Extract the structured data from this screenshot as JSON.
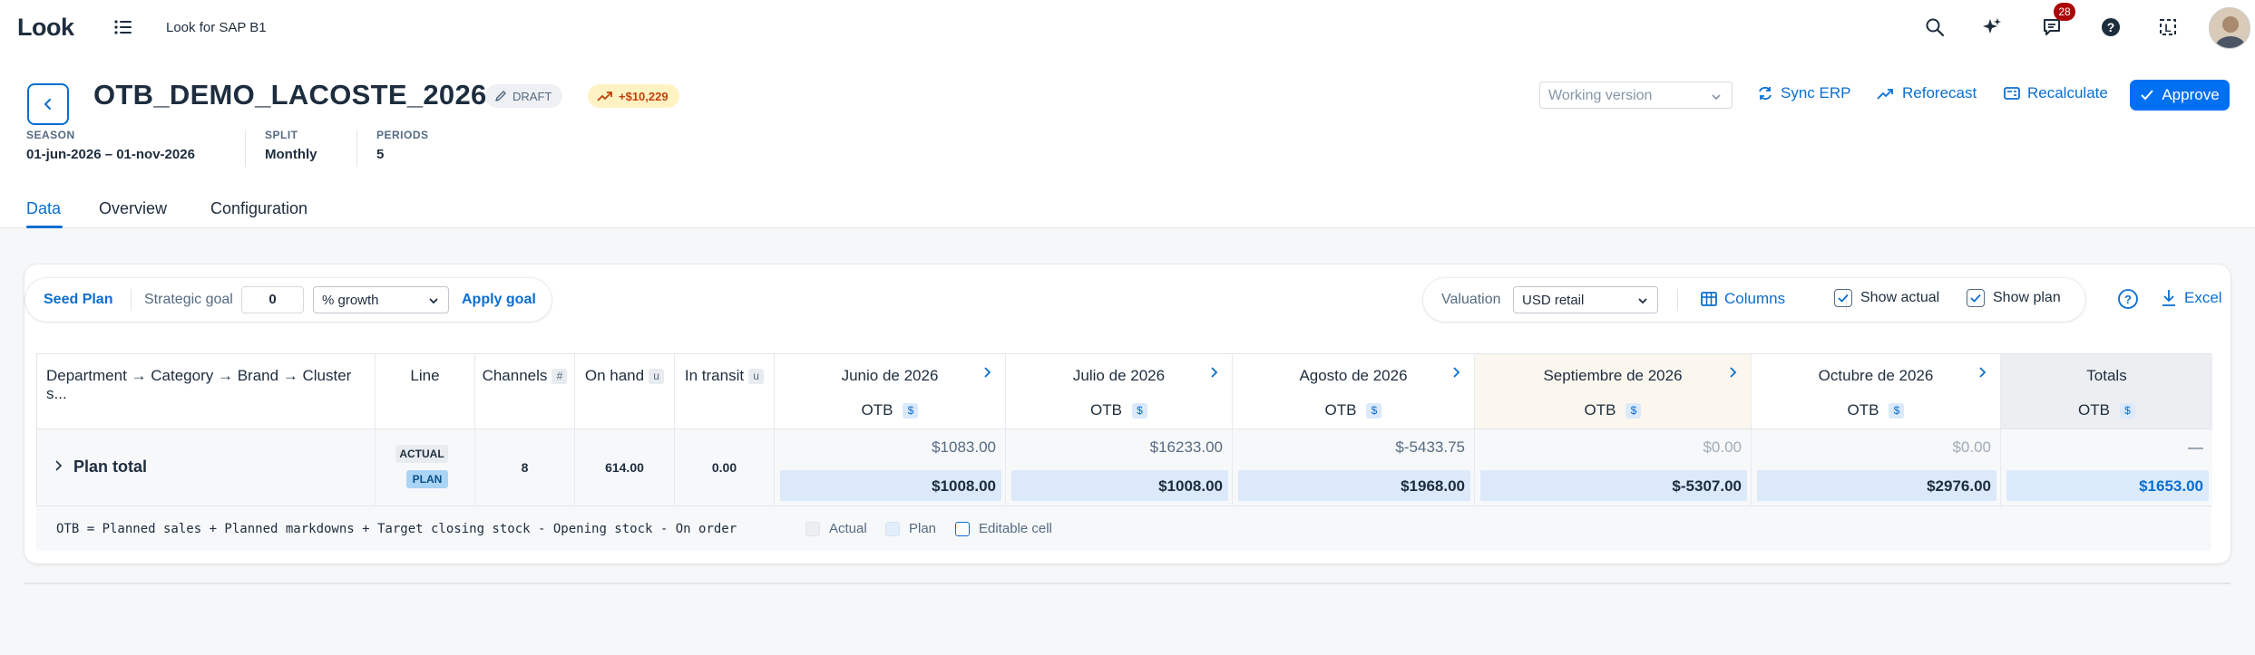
{
  "shell": {
    "logo": "Look",
    "app_name": "Look for SAP B1",
    "notifications_count": "28"
  },
  "header": {
    "title": "OTB_DEMO_LACOSTE_2026",
    "status_tag": "DRAFT",
    "delta_tag": "+$10,229",
    "meta": [
      {
        "label": "SEASON",
        "value": "01-jun-2026 – 01-nov-2026"
      },
      {
        "label": "SPLIT",
        "value": "Monthly"
      },
      {
        "label": "PERIODS",
        "value": "5"
      }
    ],
    "version_placeholder": "Working version",
    "actions": {
      "sync": "Sync ERP",
      "reforecast": "Reforecast",
      "recalculate": "Recalculate",
      "approve": "Approve"
    },
    "tabs": [
      "Data",
      "Overview",
      "Configuration"
    ],
    "active_tab": "Data"
  },
  "toolbar": {
    "seed_plan": "Seed Plan",
    "strategic_goal_label": "Strategic goal",
    "strategic_goal_value": "0",
    "growth_option": "% growth",
    "apply_goal": "Apply goal",
    "valuation_label": "Valuation",
    "valuation_value": "USD retail",
    "columns": "Columns",
    "show_actual": "Show actual",
    "show_plan": "Show plan",
    "show_actual_checked": true,
    "show_plan_checked": true,
    "excel": "Excel"
  },
  "table": {
    "headers": {
      "hierarchy": "Department → Category → Brand → Cluster s...",
      "line": "Line",
      "channels": "Channels",
      "channels_unit": "#",
      "on_hand": "On hand",
      "on_hand_unit": "u",
      "in_transit": "In transit",
      "in_transit_unit": "u"
    },
    "otb_label": "OTB",
    "currency_unit": "$",
    "periods": [
      {
        "name": "Junio de 2026",
        "actual": "$1083.00",
        "plan": "$1008.00"
      },
      {
        "name": "Julio de 2026",
        "actual": "$16233.00",
        "plan": "$1008.00"
      },
      {
        "name": "Agosto de 2026",
        "actual": "$-5433.75",
        "plan": "$1968.00"
      },
      {
        "name": "Septiembre de 2026",
        "actual": "$0.00",
        "plan": "$-5307.00"
      },
      {
        "name": "Octubre de 2026",
        "actual": "$0.00",
        "plan": "$2976.00"
      }
    ],
    "totals": {
      "name": "Totals",
      "actual": "—",
      "plan": "$1653.00"
    },
    "row": {
      "label": "Plan total",
      "tag_actual": "ACTUAL",
      "tag_plan": "PLAN",
      "channels": "8",
      "on_hand": "614.00",
      "in_transit": "0.00"
    }
  },
  "footer": {
    "formula": "OTB = Planned sales + Planned markdowns + Target closing stock - Opening stock - On order",
    "legend": [
      "Actual",
      "Plan",
      "Editable cell"
    ]
  }
}
